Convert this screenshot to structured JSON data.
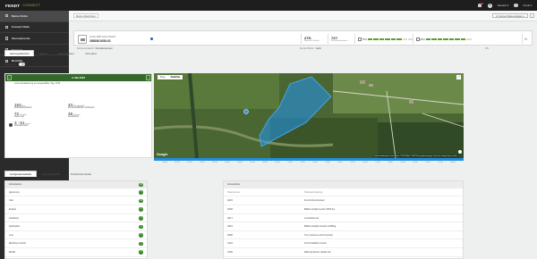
{
  "brand": {
    "logo": "FENDT",
    "sub": "CONNECT"
  },
  "topbar": {
    "language": "Deutsch ▾",
    "user": "Frank ▾",
    "help": "?"
  },
  "sidebar": {
    "items": [
      {
        "label": "Meine Flotte"
      },
      {
        "label": "Connect Data"
      },
      {
        "label": "Abonnements"
      },
      {
        "label": "Grenzen"
      },
      {
        "label": "Berichte"
      }
    ],
    "collapse": "«"
  },
  "breadcrumb": {
    "label": "Meine Maschinen"
  },
  "actions": {
    "export": "In Connect Data anzeigen ▾",
    "menu": "⋮"
  },
  "machine": {
    "name": "Fendt 1050 Gen3 TRACT",
    "serial": "2850301050-01",
    "stat1_value": "275",
    "stat1_unit": "h",
    "stat1_label": "Motorstd. Betrieb",
    "stat2_value": "727",
    "stat2_unit": "l",
    "stat2_label": "Kraftstoffverbrauch",
    "fuel_label": "75%",
    "fuel_level_pct": 75,
    "adblue_label": "84%",
    "adblue_level_pct": 84,
    "share": "⋖"
  },
  "info_strip": {
    "subscription_label": "Abonnementstand",
    "subscription_value": "Demoabonnement",
    "dealer_label": "Service Partner",
    "dealer_value": "Fendt",
    "vin": "VIN"
  },
  "tabs": [
    "Nutzungsübersicht",
    "Alarme",
    "Telemetriedaten",
    "Information"
  ],
  "live": {
    "label": "Live-Daten"
  },
  "day_panel": {
    "date": "9. Mai 2023",
    "prev": "‹",
    "next": "›",
    "update_line1": "Letzte Aktualisierung am ausgewählten Tag: 13:55",
    "update_line2": "",
    "values": [
      {
        "number": "164",
        "unit": "l/ha",
        "label": "Kraftstoffverbrauch"
      },
      {
        "number": "43",
        "unit": "l/ha gemittelt",
        "label": "Durchschnittlicher Verbrauch"
      },
      {
        "number": "72",
        "unit": "Prozent",
        "label": "Motor Last"
      },
      {
        "number": "28",
        "unit": "Prozent",
        "label": "Leerlaufzeit"
      },
      {
        "number": "3 : 51",
        "unit": "h:min",
        "label": "Arbeitsstunden"
      }
    ]
  },
  "map": {
    "tab_map": "Map",
    "tab_satellite": "Satellite",
    "google": "Google",
    "attribution": "Tastenkombinationen  Kartendaten ©2023 Bilder ©2023  Nutzungsbedingungen  Fehler bei Google Maps melden"
  },
  "timeline": {
    "labels": [
      "00:00",
      "01:00",
      "02:00",
      "03:00",
      "04:00",
      "05:00",
      "06:00",
      "07:00",
      "08:00",
      "09:00",
      "10:00",
      "11:00",
      "12:00",
      "13:00",
      "14:00",
      "15:00",
      "16:00",
      "17:00",
      "18:00",
      "19:00",
      "20:00",
      "21:00",
      "22:00",
      "23:00"
    ]
  },
  "bottom_tabs": [
    "Konfigurationsdetails",
    "Fertigungsdetails",
    "Zubehörteile Details"
  ],
  "accessory_list": {
    "header": "Accessories",
    "header_count": "38",
    "rows": [
      {
        "label": "Agronomy",
        "count": "1"
      },
      {
        "label": "Cab",
        "count": "12"
      },
      {
        "label": "Engine",
        "count": "2"
      },
      {
        "label": "Guidance",
        "count": "3"
      },
      {
        "label": "Hydraulics",
        "count": "4"
      },
      {
        "label": "Line",
        "count": "1"
      },
      {
        "label": "Machine Control",
        "count": "1"
      },
      {
        "label": "Model",
        "count": "9"
      }
    ]
  },
  "accessory_table": {
    "title": "Accessories",
    "columns": [
      "Teilenummer",
      "Teilebeschreibung"
    ],
    "rows": [
      [
        "A004",
        "Fendt Grip Assistant"
      ],
      [
        "A008",
        "Ballast weight system 2500 kg"
      ],
      [
        "A017",
        "2-Kreisbremse"
      ],
      [
        "A063",
        "Ballast weights wheels 2x450kg"
      ],
      [
        "A098",
        "Tyre pressure control system"
      ],
      [
        "A104",
        "Fendt Stability Control"
      ],
      [
        "A105",
        "Warning device vehicle 3m"
      ]
    ]
  },
  "colors": {
    "sidebar": "#2b2b2b",
    "header_green": "#33682a",
    "field_polygon": "#2196f3",
    "timeline_blue": "#1f8fe0",
    "badge_green": "#3d8a2d",
    "gauge_green": "#5aa02c"
  },
  "icons": [
    "bell-icon",
    "help-icon",
    "user-icon",
    "machine-icon",
    "fuel-icon",
    "adblue-icon",
    "share-icon",
    "fullscreen-icon",
    "location-pin-icon"
  ]
}
